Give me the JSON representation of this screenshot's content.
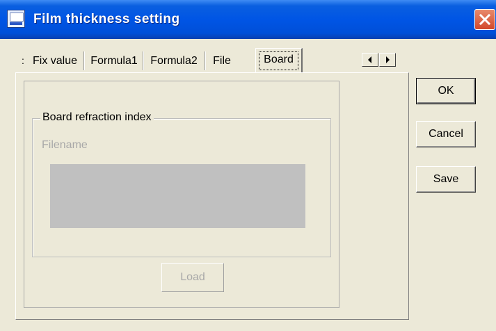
{
  "window": {
    "title": "Film thickness setting"
  },
  "tabs": [
    {
      "label": "Fix value"
    },
    {
      "label": "Formula1"
    },
    {
      "label": "Formula2"
    },
    {
      "label": "File"
    },
    {
      "label": "Board",
      "active": true
    }
  ],
  "board_panel": {
    "group_label": "Board refraction index",
    "filename_label": "Filename",
    "load_label": "Load"
  },
  "buttons": {
    "ok": "OK",
    "cancel": "Cancel",
    "save": "Save"
  },
  "icons": {
    "app": "application-icon",
    "close": "close-icon",
    "tab_left": "arrow-left-icon",
    "tab_right": "arrow-right-icon"
  }
}
